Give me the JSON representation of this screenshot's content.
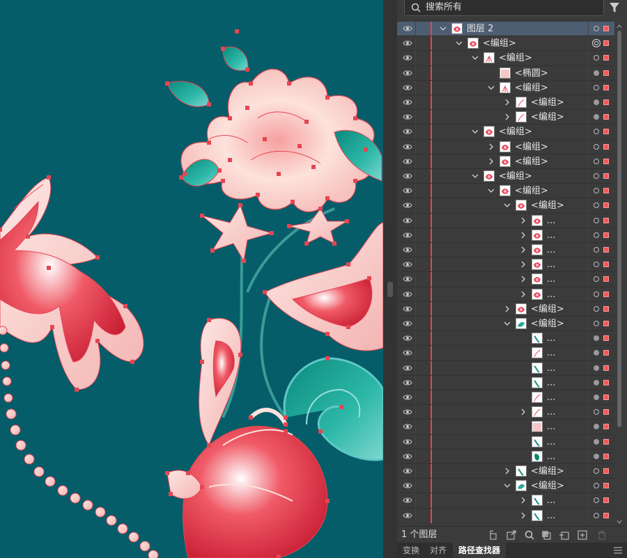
{
  "search": {
    "placeholder": "搜索所有"
  },
  "layers": [
    {
      "depth": 0,
      "chevron": "down",
      "label": "图层 2",
      "thumb": "flower",
      "target": "hollow",
      "selected": true
    },
    {
      "depth": 1,
      "chevron": "down",
      "label": "<编组>",
      "thumb": "flower",
      "target": "double"
    },
    {
      "depth": 2,
      "chevron": "down",
      "label": "<编组>",
      "thumb": "lines",
      "target": "hollow"
    },
    {
      "depth": 3,
      "chevron": "none",
      "label": "<椭圆>",
      "thumb": "pink",
      "target": "filled"
    },
    {
      "depth": 3,
      "chevron": "down",
      "label": "<编组>",
      "thumb": "lines",
      "target": "hollow"
    },
    {
      "depth": 4,
      "chevron": "right",
      "label": "<编组>",
      "thumb": "stroke",
      "target": "filled"
    },
    {
      "depth": 4,
      "chevron": "right",
      "label": "<编组>",
      "thumb": "stroke",
      "target": "filled"
    },
    {
      "depth": 2,
      "chevron": "down",
      "label": "<编组>",
      "thumb": "flower",
      "target": "hollow"
    },
    {
      "depth": 3,
      "chevron": "right",
      "label": "<编组>",
      "thumb": "flower",
      "target": "hollow"
    },
    {
      "depth": 3,
      "chevron": "right",
      "label": "<编组>",
      "thumb": "flower",
      "target": "hollow"
    },
    {
      "depth": 2,
      "chevron": "down",
      "label": "<编组>",
      "thumb": "flower",
      "target": "hollow"
    },
    {
      "depth": 3,
      "chevron": "down",
      "label": "<编组>",
      "thumb": "flower",
      "target": "hollow"
    },
    {
      "depth": 4,
      "chevron": "down",
      "label": "<编组>",
      "thumb": "flower",
      "target": "hollow"
    },
    {
      "depth": 5,
      "chevron": "right",
      "label": "...",
      "thumb": "flower",
      "target": "hollow"
    },
    {
      "depth": 5,
      "chevron": "right",
      "label": "...",
      "thumb": "flower",
      "target": "hollow"
    },
    {
      "depth": 5,
      "chevron": "right",
      "label": "...",
      "thumb": "flower",
      "target": "hollow"
    },
    {
      "depth": 5,
      "chevron": "right",
      "label": "...",
      "thumb": "flower",
      "target": "hollow"
    },
    {
      "depth": 5,
      "chevron": "right",
      "label": "...",
      "thumb": "flower",
      "target": "hollow"
    },
    {
      "depth": 5,
      "chevron": "right",
      "label": "...",
      "thumb": "flower",
      "target": "hollow"
    },
    {
      "depth": 4,
      "chevron": "right",
      "label": "<编组>",
      "thumb": "flower",
      "target": "hollow"
    },
    {
      "depth": 4,
      "chevron": "down",
      "label": "<编组>",
      "thumb": "teal",
      "target": "hollow"
    },
    {
      "depth": 5,
      "chevron": "none",
      "label": "...",
      "thumb": "tealstroke",
      "target": "filled"
    },
    {
      "depth": 5,
      "chevron": "none",
      "label": "...",
      "thumb": "stroke",
      "target": "filled"
    },
    {
      "depth": 5,
      "chevron": "none",
      "label": "...",
      "thumb": "tealstroke",
      "target": "filled"
    },
    {
      "depth": 5,
      "chevron": "none",
      "label": "...",
      "thumb": "tealstroke",
      "target": "filled"
    },
    {
      "depth": 5,
      "chevron": "none",
      "label": "...",
      "thumb": "stroke",
      "target": "filled"
    },
    {
      "depth": 5,
      "chevron": "right",
      "label": "...",
      "thumb": "stroke",
      "target": "hollow"
    },
    {
      "depth": 5,
      "chevron": "none",
      "label": "...",
      "thumb": "pink",
      "target": "filled"
    },
    {
      "depth": 5,
      "chevron": "none",
      "label": "...",
      "thumb": "tealstroke",
      "target": "filled"
    },
    {
      "depth": 5,
      "chevron": "none",
      "label": "...",
      "thumb": "tealfill",
      "target": "filled"
    },
    {
      "depth": 4,
      "chevron": "right",
      "label": "<编组>",
      "thumb": "tealstroke",
      "target": "hollow"
    },
    {
      "depth": 4,
      "chevron": "down",
      "label": "<编组>",
      "thumb": "teal",
      "target": "hollow"
    },
    {
      "depth": 5,
      "chevron": "right",
      "label": "...",
      "thumb": "tealstroke",
      "target": "hollow"
    },
    {
      "depth": 5,
      "chevron": "right",
      "label": "...",
      "thumb": "tealstroke",
      "target": "hollow"
    }
  ],
  "footer": {
    "layer_count": "1 个图层"
  },
  "tabs": [
    {
      "label": "变换",
      "active": false
    },
    {
      "label": "对齐",
      "active": false
    },
    {
      "label": "路径查找器",
      "active": true
    }
  ],
  "colors": {
    "canvas": "#055d6a",
    "accent_red": "#e64552",
    "selection": "#4d5d72",
    "panel": "#3b3b3b"
  }
}
